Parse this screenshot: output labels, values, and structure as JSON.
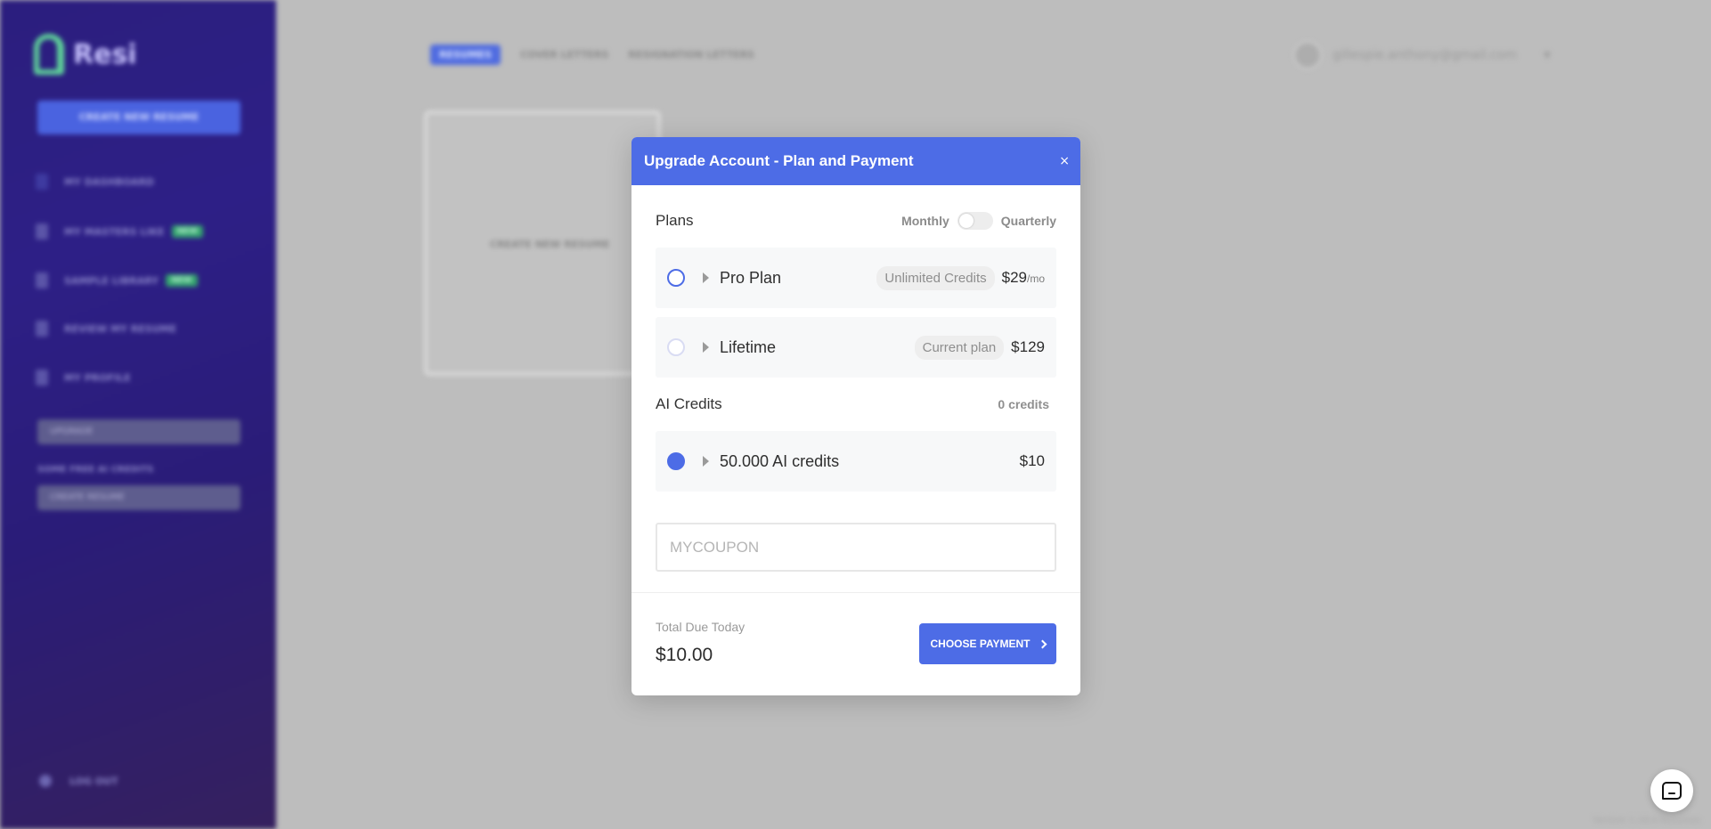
{
  "background": {
    "brand": "Resi",
    "sidebar": {
      "create_button": "CREATE NEW RESUME",
      "items": [
        {
          "label": "MY DASHBOARD",
          "badge": ""
        },
        {
          "label": "MY MASTERS LIKE",
          "badge": "NEW"
        },
        {
          "label": "SAMPLE LIBRARY",
          "badge": "NEW"
        },
        {
          "label": "REVIEW MY RESUME",
          "badge": ""
        },
        {
          "label": "MY PROFILE",
          "badge": ""
        }
      ],
      "upgrade_select": "UPGRADE",
      "credits_label": "SOME FREE AI CREDITS",
      "resume_select": "CREATE RESUME",
      "logout": "LOG OUT"
    },
    "topnav": [
      "RESUMES",
      "COVER LETTERS",
      "RESIGNATION LETTERS"
    ],
    "user_email": "gillespie.anthony@gmail.com",
    "new_card_label": "CREATE NEW RESUME",
    "version": "Version 1.18.0 Resumes"
  },
  "modal": {
    "title": "Upgrade Account - Plan and Payment",
    "close": "×",
    "plans_title": "Plans",
    "toggle_left": "Monthly",
    "toggle_right": "Quarterly",
    "plans": [
      {
        "name": "Pro Plan",
        "pill": "Unlimited Credits",
        "price": "$29",
        "unit": "/mo",
        "state": "unselected"
      },
      {
        "name": "Lifetime",
        "pill": "Current plan",
        "price": "$129",
        "unit": "",
        "state": "disabled"
      }
    ],
    "credits_title": "AI Credits",
    "credits_count": "0 credits",
    "credit_option": {
      "name": "50.000 AI credits",
      "price": "$10",
      "state": "selected"
    },
    "coupon_placeholder": "MYCOUPON",
    "total_label": "Total Due Today",
    "total_value": "$10.00",
    "pay_button": "CHOOSE PAYMENT"
  },
  "colors": {
    "accent": "#4d6ce6",
    "sidebar": "#2b1e7e",
    "logo": "#5fd39a"
  },
  "chat": {
    "icon": "chat-bubble-icon"
  }
}
